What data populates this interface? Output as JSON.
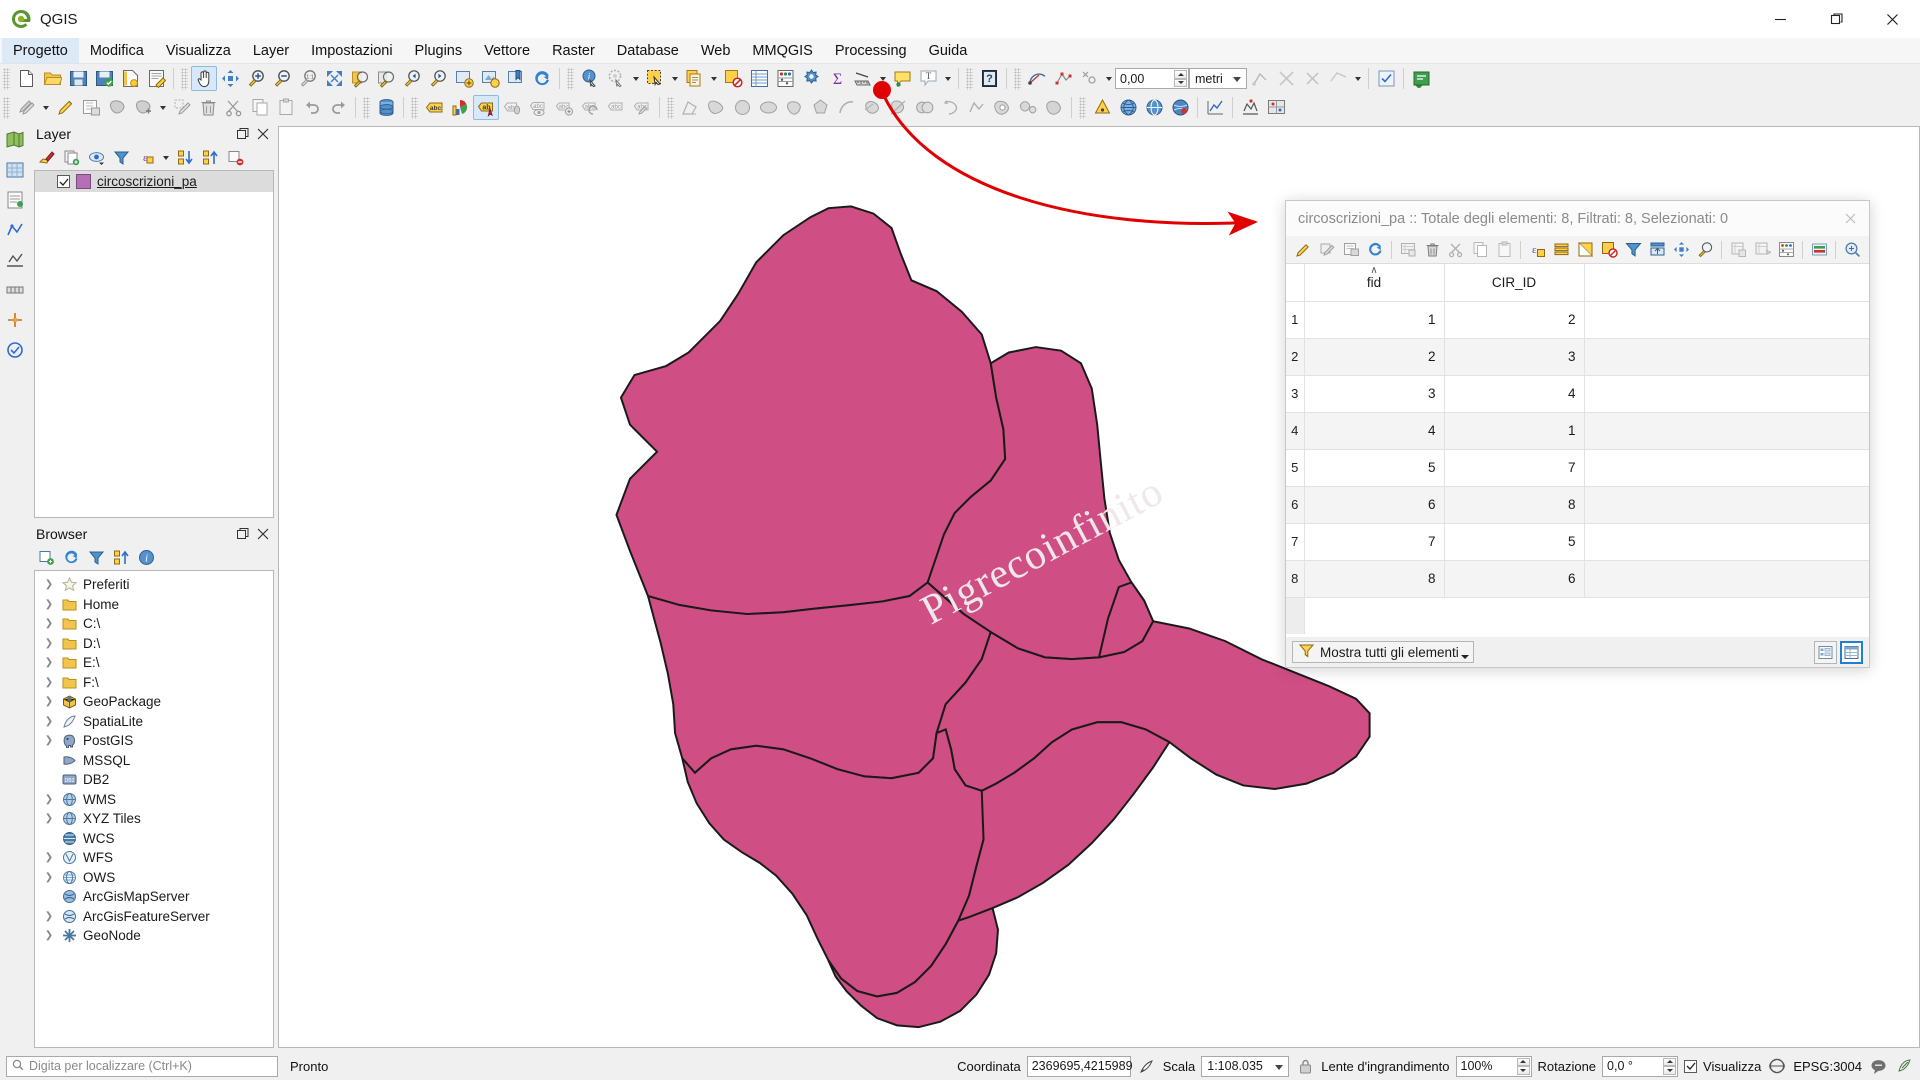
{
  "window": {
    "title": "QGIS",
    "controls": {
      "minimize": "minimize-icon",
      "maximize": "maximize-icon",
      "close": "close-icon"
    }
  },
  "menubar": {
    "items": [
      {
        "label": "Progetto",
        "mnemonic": "r",
        "active": true
      },
      {
        "label": "Modifica",
        "mnemonic": "M"
      },
      {
        "label": "Visualizza",
        "mnemonic": "V"
      },
      {
        "label": "Layer",
        "mnemonic": "L"
      },
      {
        "label": "Impostazioni",
        "mnemonic": "I"
      },
      {
        "label": "Plugins",
        "mnemonic": "P"
      },
      {
        "label": "Vettore",
        "mnemonic": "o"
      },
      {
        "label": "Raster",
        "mnemonic": "R"
      },
      {
        "label": "Database",
        "mnemonic": "D"
      },
      {
        "label": "Web",
        "mnemonic": "W"
      },
      {
        "label": "MMQGIS"
      },
      {
        "label": "Processing",
        "mnemonic": "g"
      },
      {
        "label": "Guida",
        "mnemonic": "G"
      }
    ]
  },
  "toolbar": {
    "measure_value": "0,00",
    "measure_unit": "metri"
  },
  "panels": {
    "layer": {
      "title": "Layer",
      "layers": [
        {
          "name": "circoscrizioni_pa",
          "checked": true,
          "color": "#b46fb6"
        }
      ]
    },
    "browser": {
      "title": "Browser",
      "items": [
        {
          "label": "Preferiti",
          "icon": "star-icon",
          "expandable": true
        },
        {
          "label": "Home",
          "icon": "folder-icon",
          "expandable": true
        },
        {
          "label": "C:\\",
          "icon": "folder-icon",
          "expandable": true
        },
        {
          "label": "D:\\",
          "icon": "folder-icon",
          "expandable": true
        },
        {
          "label": "E:\\",
          "icon": "folder-icon",
          "expandable": true
        },
        {
          "label": "F:\\",
          "icon": "folder-icon",
          "expandable": true
        },
        {
          "label": "GeoPackage",
          "icon": "geopackage-icon",
          "expandable": true
        },
        {
          "label": "SpatiaLite",
          "icon": "spatialite-icon",
          "expandable": true
        },
        {
          "label": "PostGIS",
          "icon": "postgis-elephant-icon",
          "expandable": true
        },
        {
          "label": "MSSQL",
          "icon": "mssql-icon",
          "expandable": false
        },
        {
          "label": "DB2",
          "icon": "db2-icon",
          "expandable": false
        },
        {
          "label": "WMS",
          "icon": "globe-icon",
          "expandable": true
        },
        {
          "label": "XYZ Tiles",
          "icon": "globe-icon",
          "expandable": true
        },
        {
          "label": "WCS",
          "icon": "globe-icon",
          "expandable": true
        },
        {
          "label": "WFS",
          "icon": "globe-icon",
          "expandable": true
        },
        {
          "label": "OWS",
          "icon": "globe-icon",
          "expandable": true
        },
        {
          "label": "ArcGisMapServer",
          "icon": "globe-icon",
          "expandable": false
        },
        {
          "label": "ArcGisFeatureServer",
          "icon": "globe-icon",
          "expandable": true
        },
        {
          "label": "GeoNode",
          "icon": "geonode-icon",
          "expandable": true
        }
      ]
    }
  },
  "map": {
    "watermark": "Pigrecoinfinito",
    "fill_color": "#cf4e84",
    "stroke_color": "#1a1a1a"
  },
  "attribute_table": {
    "title": "circoscrizioni_pa :: Totale degli elementi: 8, Filtrati: 8, Selezionati: 0",
    "columns": [
      "fid",
      "CIR_ID"
    ],
    "sorted_column": "fid",
    "sort_direction": "asc",
    "rows": [
      {
        "n": "1",
        "fid": "1",
        "CIR_ID": "2"
      },
      {
        "n": "2",
        "fid": "2",
        "CIR_ID": "3"
      },
      {
        "n": "3",
        "fid": "3",
        "CIR_ID": "4"
      },
      {
        "n": "4",
        "fid": "4",
        "CIR_ID": "1"
      },
      {
        "n": "5",
        "fid": "5",
        "CIR_ID": "7"
      },
      {
        "n": "6",
        "fid": "6",
        "CIR_ID": "8"
      },
      {
        "n": "7",
        "fid": "7",
        "CIR_ID": "5"
      },
      {
        "n": "8",
        "fid": "8",
        "CIR_ID": "6"
      }
    ],
    "filter_label": "Mostra tutti gli elementi"
  },
  "statusbar": {
    "locator_placeholder": "Digita per localizzare (Ctrl+K)",
    "ready": "Pronto",
    "coordinate_label": "Coordinata",
    "coordinate_value": "2369695,4215989",
    "scale_label": "Scala",
    "scale_value": "1:108.035",
    "magnifier_label": "Lente d'ingrandimento",
    "magnifier_value": "100%",
    "rotation_label": "Rotazione",
    "rotation_value": "0,0 °",
    "render_label": "Visualizza",
    "render_checked": true,
    "crs_label": "EPSG:3004"
  },
  "annotation": {
    "arrow_color": "#e00000"
  }
}
